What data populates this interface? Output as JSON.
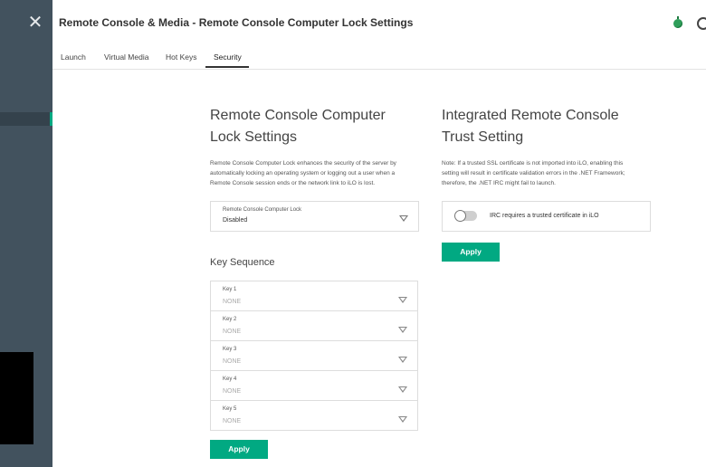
{
  "header": {
    "title": "Remote Console & Media - Remote Console Computer Lock Settings"
  },
  "tabs": [
    {
      "label": "Launch"
    },
    {
      "label": "Virtual Media"
    },
    {
      "label": "Hot Keys"
    },
    {
      "label": "Security",
      "active": true
    }
  ],
  "lock": {
    "heading_line1": "Remote Console Computer",
    "heading_line2": "Lock Settings",
    "desc_line1": "Remote Console Computer Lock enhances the security of the server by",
    "desc_line2": "automatically locking an operating system or logging out a user when a",
    "desc_line3": "Remote Console session ends or the network link to iLO is lost.",
    "select_label": "Remote Console Computer Lock",
    "select_value": "Disabled"
  },
  "key_sequence": {
    "heading": "Key Sequence",
    "keys": [
      {
        "label": "Key 1",
        "value": "NONE"
      },
      {
        "label": "Key 2",
        "value": "NONE"
      },
      {
        "label": "Key 3",
        "value": "NONE"
      },
      {
        "label": "Key 4",
        "value": "NONE"
      },
      {
        "label": "Key 5",
        "value": "NONE"
      }
    ],
    "apply_label": "Apply"
  },
  "trust": {
    "heading_line1": "Integrated Remote Console",
    "heading_line2": "Trust Setting",
    "note_line1": "Note: If a trusted SSL certificate is not imported into iLO, enabling this",
    "note_line2": "setting will result in certificate validation errors in the .NET Framework;",
    "note_line3": "therefore, the .NET IRC might fail to launch.",
    "toggle_label": "IRC requires a trusted certificate in iLO",
    "toggle_on": false,
    "apply_label": "Apply"
  },
  "colors": {
    "accent": "#01a982",
    "sidebar": "#42525e",
    "status": "#2f9e5a"
  },
  "icons": {
    "close": "close-icon",
    "status": "status-icon",
    "settings": "gear-icon",
    "dropdown": "chevron-down-icon"
  }
}
